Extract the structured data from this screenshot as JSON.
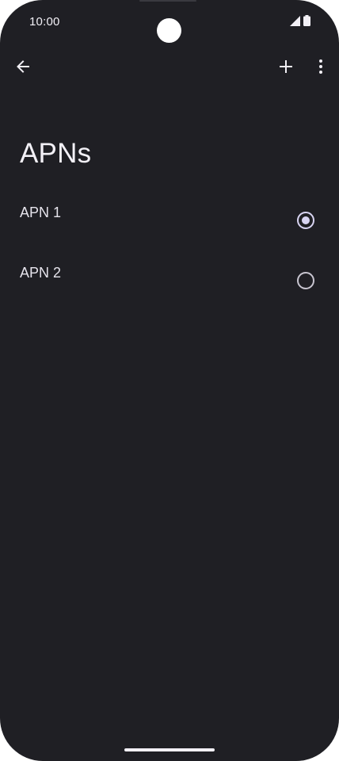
{
  "status_bar": {
    "time": "10:00",
    "icons": [
      "signal-icon",
      "battery-icon"
    ]
  },
  "app_bar": {
    "back_icon": "arrow-back-icon",
    "add_icon": "plus-icon",
    "more_icon": "more-vert-icon"
  },
  "page": {
    "title": "APNs"
  },
  "apn_list": [
    {
      "label": "APN 1",
      "selected": true
    },
    {
      "label": "APN 2",
      "selected": false
    }
  ],
  "colors": {
    "background": "#1f1f24",
    "text": "#e6e4ec",
    "accent": "#d8d4f2"
  }
}
